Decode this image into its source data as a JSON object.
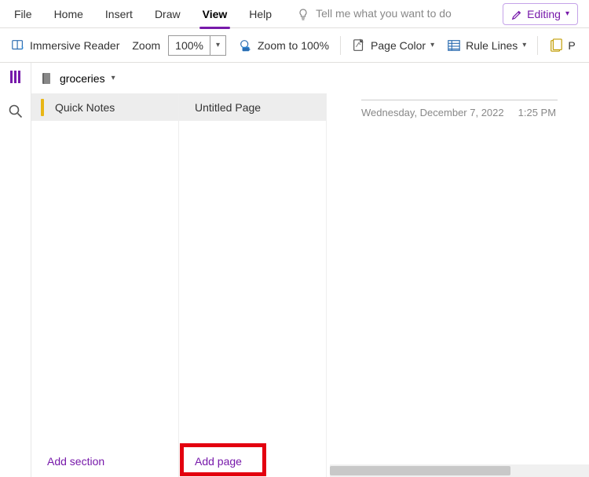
{
  "tabs": {
    "file": "File",
    "home": "Home",
    "insert": "Insert",
    "draw": "Draw",
    "view": "View",
    "help": "Help"
  },
  "tell_me": "Tell me what you want to do",
  "editing": "Editing",
  "ribbon": {
    "immersive": "Immersive Reader",
    "zoom_label": "Zoom",
    "zoom_value": "100%",
    "zoom_100": "Zoom to 100%",
    "page_color": "Page Color",
    "rule_lines": "Rule Lines",
    "paper_partial": "P"
  },
  "notebook_name": "groceries",
  "section_active": "Quick Notes",
  "page_active": "Untitled Page",
  "add_section": "Add section",
  "add_page": "Add page",
  "note_date": "Wednesday, December 7, 2022",
  "note_time": "1:25 PM"
}
